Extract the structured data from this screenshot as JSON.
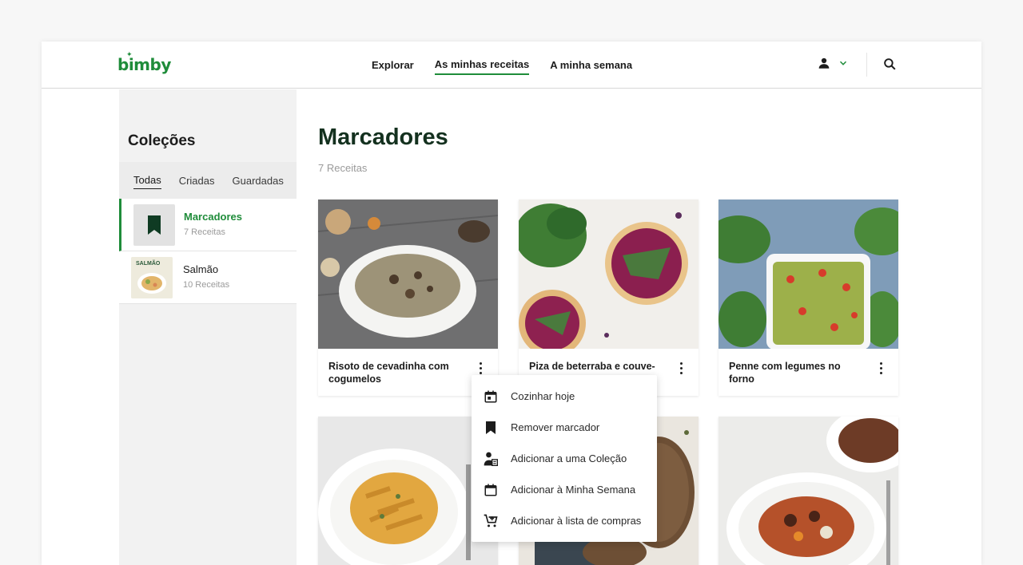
{
  "brand": {
    "logo_text": "bimby",
    "accent": "#1f8c3a"
  },
  "nav": {
    "items": [
      {
        "label": "Explorar"
      },
      {
        "label": "As minhas receitas"
      },
      {
        "label": "A minha semana"
      }
    ],
    "active": "As minhas receitas"
  },
  "header": {
    "user_icon": "person-icon",
    "search_icon": "search-icon"
  },
  "sidebar": {
    "title": "Coleções",
    "tabs": [
      {
        "label": "Todas"
      },
      {
        "label": "Criadas"
      },
      {
        "label": "Guardadas"
      }
    ],
    "collections": [
      {
        "name": "Marcadores",
        "count": "7 Receitas",
        "icon": "bookmark-icon"
      },
      {
        "name": "Salmão",
        "count": "10 Receitas",
        "thumb_text": "SALMÃO"
      }
    ]
  },
  "main": {
    "title": "Marcadores",
    "count": "7 Receitas",
    "recipes": [
      {
        "title": "Risoto de cevadinha com cogumelos"
      },
      {
        "title": "Piza de beterraba e couve-"
      },
      {
        "title": "Penne com legumes no forno"
      },
      {
        "title": ""
      },
      {
        "title": ""
      },
      {
        "title": ""
      }
    ]
  },
  "context_menu": {
    "items": [
      {
        "label": "Cozinhar hoje",
        "icon": "calendar-today-icon"
      },
      {
        "label": "Remover marcador",
        "icon": "bookmark-icon"
      },
      {
        "label": "Adicionar a uma Coleção",
        "icon": "add-to-collection-icon"
      },
      {
        "label": "Adicionar à Minha Semana",
        "icon": "calendar-icon"
      },
      {
        "label": "Adicionar à lista de compras",
        "icon": "add-shopping-cart-icon"
      }
    ]
  }
}
